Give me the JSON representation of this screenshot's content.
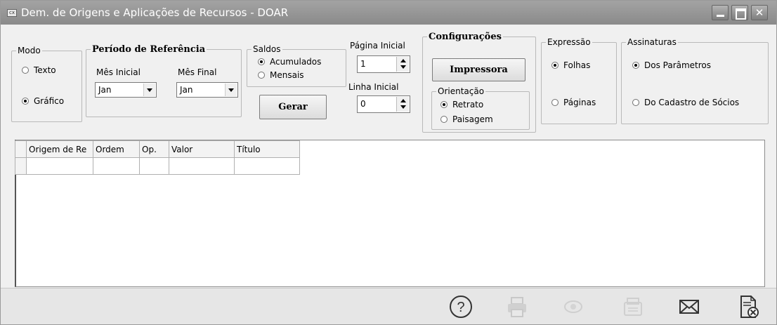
{
  "window": {
    "title": "Dem. de Origens e Aplicações de Recursos - DOAR",
    "icon": "app-icon"
  },
  "modo": {
    "legend": "Modo",
    "options": [
      {
        "label": "Texto",
        "selected": false
      },
      {
        "label": "Gráfico",
        "selected": true
      }
    ]
  },
  "periodo": {
    "legend": "Período de Referência",
    "mes_inicial_label": "Mês Inicial",
    "mes_final_label": "Mês Final",
    "mes_inicial_value": "Jan",
    "mes_final_value": "Jan"
  },
  "saldos": {
    "legend": "Saldos",
    "options": [
      {
        "label": "Acumulados",
        "selected": true
      },
      {
        "label": "Mensais",
        "selected": false
      }
    ]
  },
  "gerar_label": "Gerar",
  "pagina_inicial": {
    "label": "Página Inicial",
    "value": "1"
  },
  "linha_inicial": {
    "label": "Linha Inicial",
    "value": "0"
  },
  "configuracoes": {
    "legend": "Configurações",
    "impressora_label": "Impressora",
    "orientacao": {
      "legend": "Orientação",
      "options": [
        {
          "label": "Retrato",
          "selected": true
        },
        {
          "label": "Paisagem",
          "selected": false
        }
      ]
    }
  },
  "expressao": {
    "legend": "Expressão",
    "options": [
      {
        "label": "Folhas",
        "selected": true
      },
      {
        "label": "Páginas",
        "selected": false
      }
    ]
  },
  "assinaturas": {
    "legend": "Assinaturas",
    "options": [
      {
        "label": "Dos Parâmetros",
        "selected": true
      },
      {
        "label": "Do Cadastro de Sócios",
        "selected": false
      }
    ]
  },
  "grid": {
    "columns": [
      "Origem de Re",
      "Ordem",
      "Op.",
      "Valor",
      "Título"
    ]
  },
  "toolbar": {
    "icons": [
      "help-icon",
      "printer-icon",
      "preview-icon",
      "fax-icon",
      "email-icon",
      "close-report-icon"
    ]
  }
}
